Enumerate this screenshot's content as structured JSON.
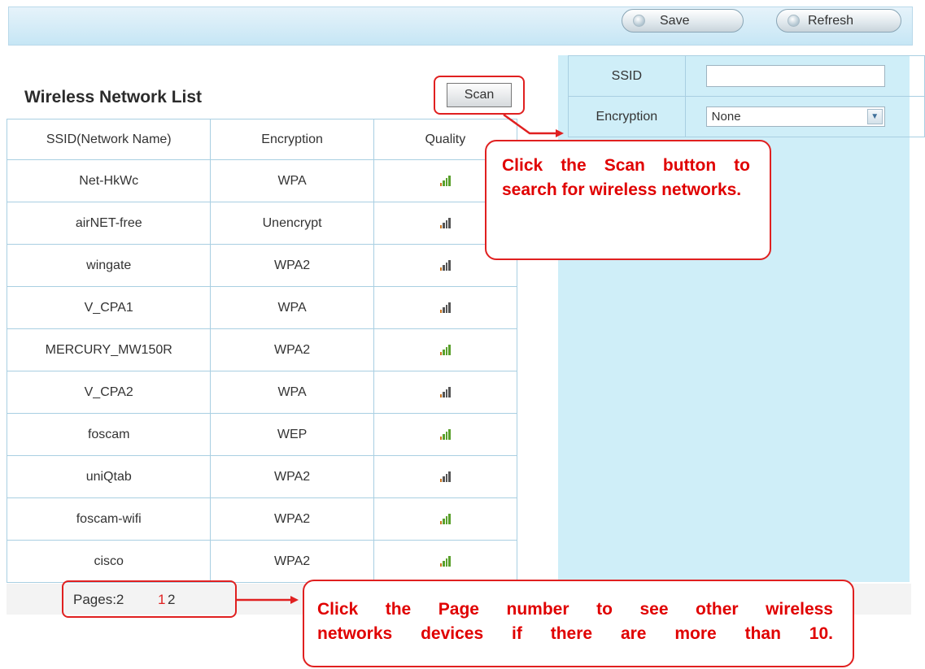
{
  "toolbar": {
    "save_label": "Save",
    "refresh_label": "Refresh"
  },
  "wireless_list": {
    "title": "Wireless Network List",
    "scan_label": "Scan",
    "columns": [
      "SSID(Network Name)",
      "Encryption",
      "Quality"
    ],
    "rows": [
      {
        "ssid": "Net-HkWc",
        "encryption": "WPA",
        "quality": "good"
      },
      {
        "ssid": "airNET-free",
        "encryption": "Unencrypt",
        "quality": "fair"
      },
      {
        "ssid": "wingate",
        "encryption": "WPA2",
        "quality": "fair"
      },
      {
        "ssid": "V_CPA1",
        "encryption": "WPA",
        "quality": "fair"
      },
      {
        "ssid": "MERCURY_MW150R",
        "encryption": "WPA2",
        "quality": "good"
      },
      {
        "ssid": "V_CPA2",
        "encryption": "WPA",
        "quality": "fair"
      },
      {
        "ssid": "foscam",
        "encryption": "WEP",
        "quality": "good"
      },
      {
        "ssid": "uniQtab",
        "encryption": "WPA2",
        "quality": "fair"
      },
      {
        "ssid": "foscam-wifi",
        "encryption": "WPA2",
        "quality": "good"
      },
      {
        "ssid": "cisco",
        "encryption": "WPA2",
        "quality": "good"
      }
    ]
  },
  "pagination": {
    "label": "Pages:2",
    "pages": [
      "1",
      "2"
    ],
    "current": "1"
  },
  "form": {
    "ssid_label": "SSID",
    "ssid_value": "",
    "encryption_label": "Encryption",
    "encryption_value": "None"
  },
  "callouts": {
    "scan_text": "Click the Scan button to search for wireless networks.",
    "page_line1": "Click the Page number to see other wireless",
    "page_line2": "networks devices if there are more than 10."
  },
  "colors": {
    "annotation_red": "#e02020",
    "signal_good": "#5aa02c",
    "signal_fair": "#555555",
    "signal_low": "#c8741e",
    "panel_blue": "#cfeef8"
  }
}
